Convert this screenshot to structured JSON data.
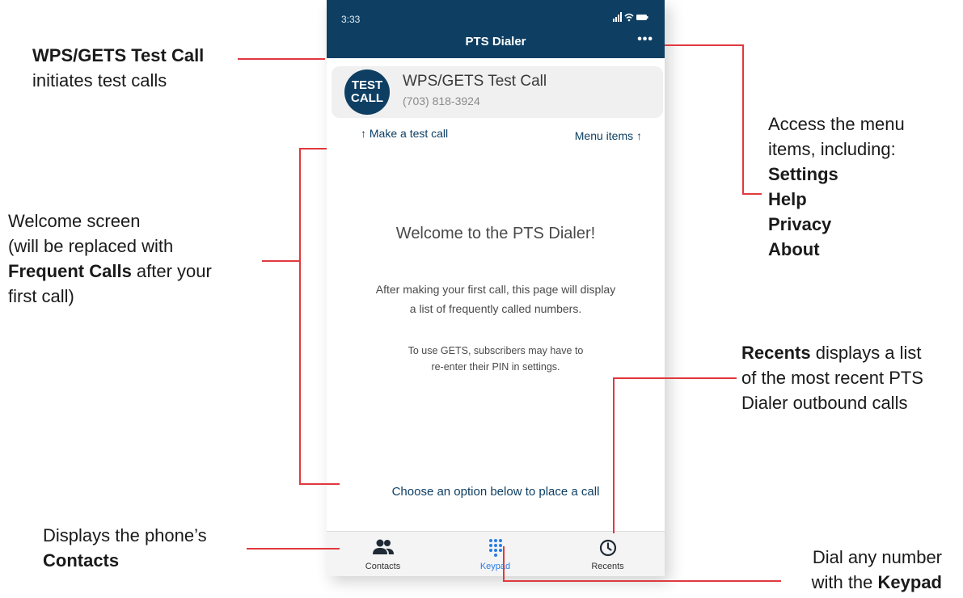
{
  "phone": {
    "status": {
      "time": "3:33",
      "icons": "▐▐ ◔ ▬"
    },
    "header": {
      "title": "PTS Dialer",
      "menu_label": "•••"
    },
    "test_call": {
      "badge_line1": "TEST",
      "badge_line2": "CALL",
      "name": "WPS/GETS Test Call",
      "number": "(703) 818-3924"
    },
    "hints": {
      "left": "↑  Make a test call",
      "right": "Menu items  ↑"
    },
    "welcome": {
      "title": "Welcome to the PTS Dialer!",
      "p1_line1": "After making your first call, this page will display",
      "p1_line2": "a list of frequently called numbers.",
      "p2_line1": "To use GETS, subscribers may have to",
      "p2_line2": "re-enter their PIN in settings."
    },
    "choose_prompt": "Choose an option below to place a call",
    "tabs": [
      {
        "label": "Contacts",
        "icon": "contacts-icon"
      },
      {
        "label": "Keypad",
        "icon": "keypad-icon"
      },
      {
        "label": "Recents",
        "icon": "clock-icon"
      }
    ]
  },
  "annotations": {
    "test_call": {
      "bold": "WPS/GETS Test Call",
      "rest": "initiates test calls"
    },
    "welcome": {
      "line1": "Welcome screen",
      "line2": "(will be replaced with",
      "line3_bold": "Frequent Calls",
      "line3_rest": " after your",
      "line4": "first call)"
    },
    "contacts": {
      "line1": "Displays the phone’s",
      "bold": "Contacts"
    },
    "menu": {
      "line1": "Access the menu",
      "line2": "items, including:",
      "items": [
        "Settings",
        "Help",
        "Privacy",
        "About"
      ]
    },
    "recents": {
      "bold": "Recents",
      "line1_rest": " displays a list",
      "line2": "of the most recent PTS",
      "line3": "Dialer outbound calls"
    },
    "keypad": {
      "line1": "Dial any number",
      "line2_rest": "with the ",
      "bold": "Keypad"
    }
  },
  "colors": {
    "header": "#0e3f63",
    "accent": "#2a7de1",
    "connector": "#e0393e"
  }
}
